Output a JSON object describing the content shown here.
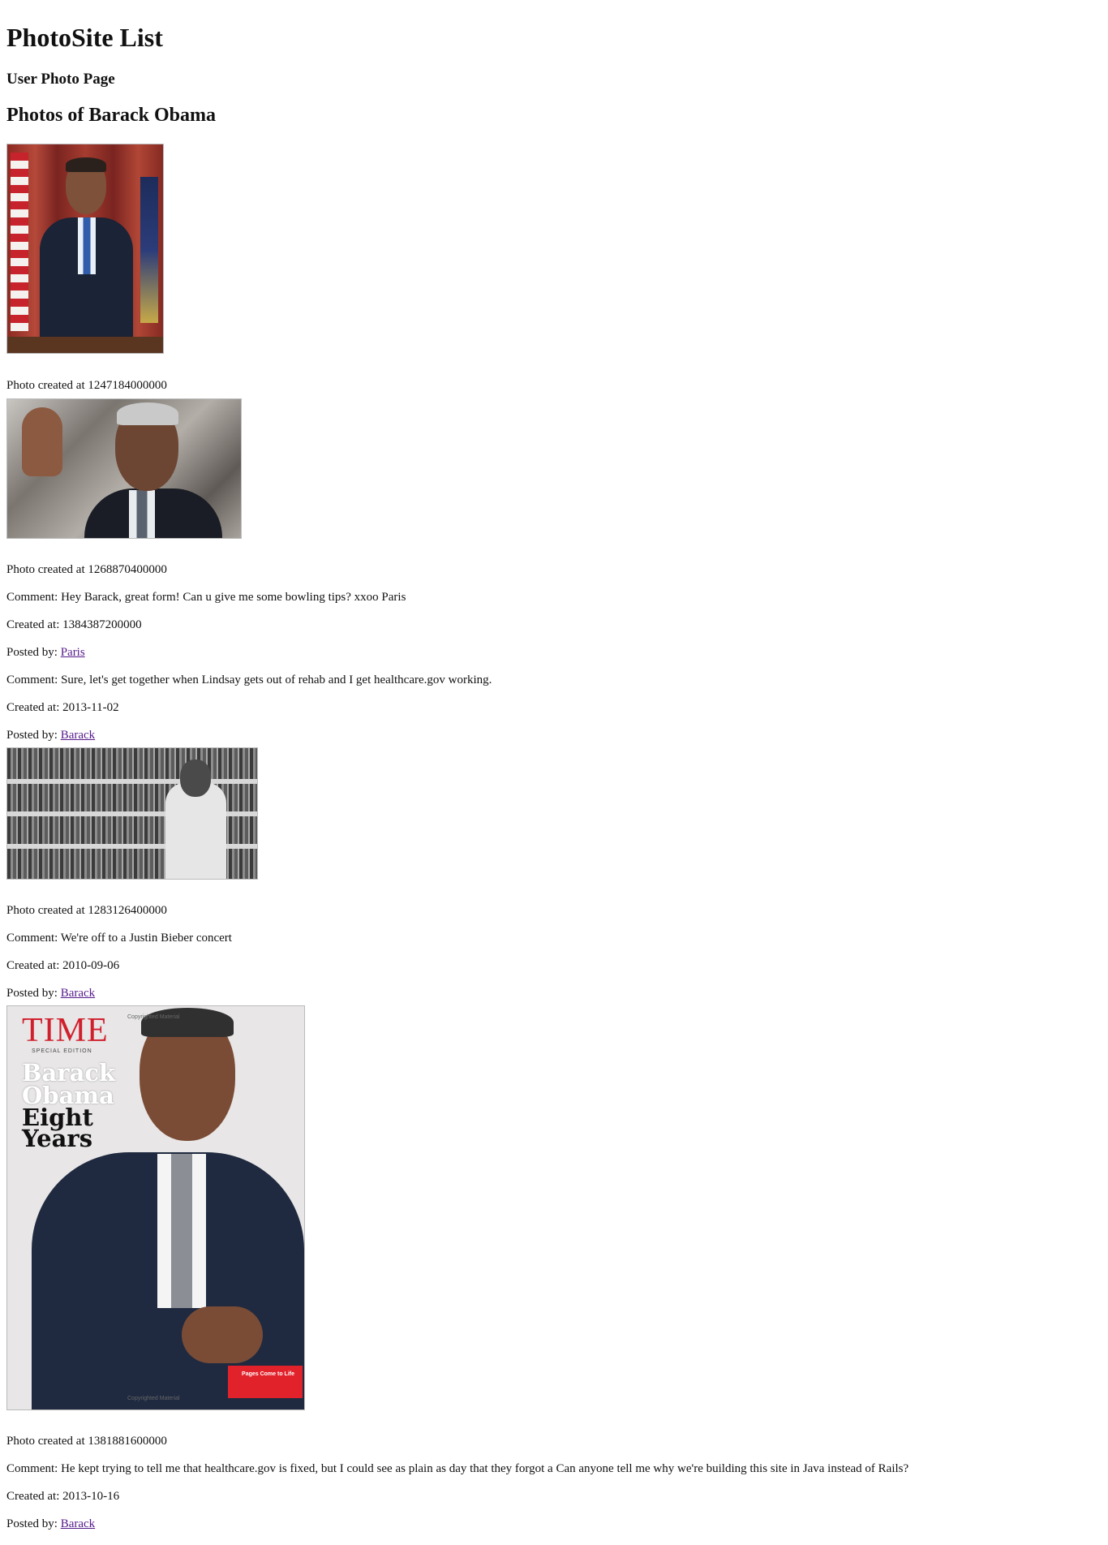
{
  "header": {
    "app_title": "PhotoSite List",
    "subtitle": "User Photo Page",
    "page_title": "Photos of Barack Obama"
  },
  "photos": [
    {
      "created_text": "Photo created at 1247184000000",
      "comments": []
    },
    {
      "created_text": "Photo created at 1268870400000",
      "comments": [
        {
          "comment_text": "Comment: Hey Barack, great form! Can u give me some bowling tips? xxoo Paris",
          "created_text": "Created at: 1384387200000",
          "posted_by_prefix": "Posted by:",
          "posted_by_link": "Paris"
        },
        {
          "comment_text": "Comment: Sure, let's get together when Lindsay gets out of rehab and I get healthcare.gov working.",
          "created_text": "Created at: 2013-11-02",
          "posted_by_prefix": "Posted by:",
          "posted_by_link": "Barack"
        }
      ]
    },
    {
      "created_text": "Photo created at 1283126400000",
      "comments": [
        {
          "comment_text": "Comment: We're off to a Justin Bieber concert",
          "created_text": "Created at: 2010-09-06",
          "posted_by_prefix": "Posted by:",
          "posted_by_link": "Barack"
        }
      ]
    },
    {
      "created_text": "Photo created at 1381881600000",
      "image_text": {
        "masthead": "TIME",
        "edition": "SPECIAL EDITION",
        "headline_line1": "Barack",
        "headline_line2": "Obama",
        "headline_line3": "Eight",
        "headline_line4": "Years",
        "copyright_top": "Copyrighted Material",
        "copyright_bottom": "Copyrighted Material",
        "badge": "Pages Come to Life"
      },
      "comments": [
        {
          "comment_text": "Comment: He kept trying to tell me that healthcare.gov is fixed, but I could see as plain as day that they forgot a Can anyone tell me why we're building this site in Java instead of Rails?",
          "created_text": "Created at: 2013-10-16",
          "posted_by_prefix": "Posted by:",
          "posted_by_link": "Barack"
        }
      ]
    }
  ],
  "colors": {
    "link": "#551a8b",
    "text": "#111111",
    "background": "#ffffff"
  }
}
